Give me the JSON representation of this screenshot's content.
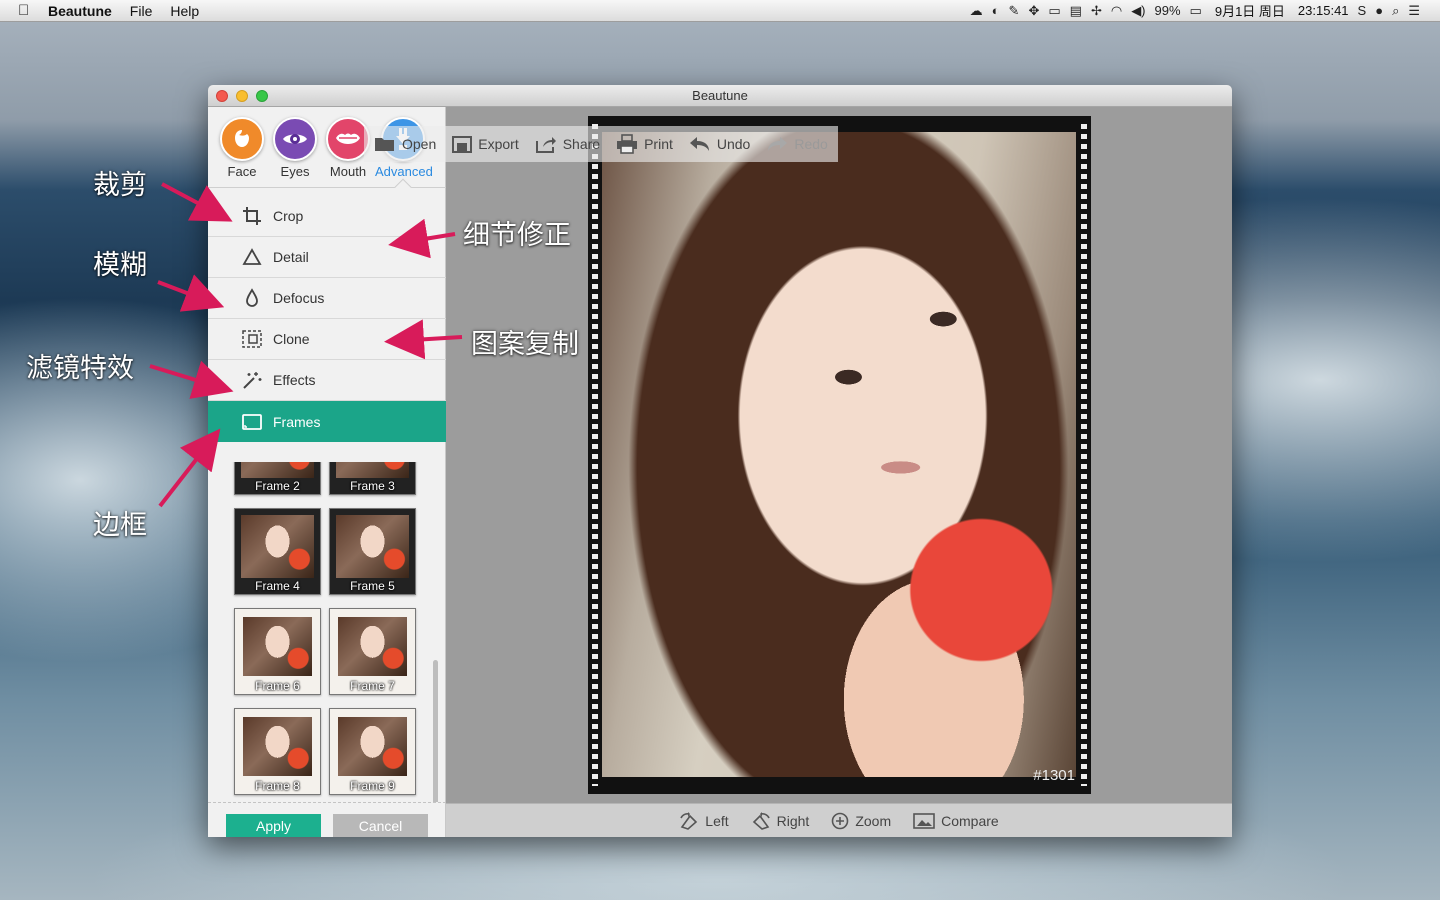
{
  "menubar": {
    "apple": "",
    "app_name": "Beautune",
    "menus": [
      "File",
      "Help"
    ],
    "battery": "99%",
    "date": "9月1日 周日",
    "time": "23:15:41"
  },
  "window": {
    "title": "Beautune"
  },
  "top_tabs": [
    {
      "label": "Face",
      "color": "#f08a2a",
      "icon": "face-icon"
    },
    {
      "label": "Eyes",
      "color": "#7a4bb3",
      "icon": "eye-icon"
    },
    {
      "label": "Mouth",
      "color": "#e2456a",
      "icon": "lips-icon"
    },
    {
      "label": "Advanced",
      "color": "#3d95e6",
      "icon": "advanced-icon"
    }
  ],
  "tools": [
    {
      "label": "Crop",
      "icon": "crop-icon"
    },
    {
      "label": "Detail",
      "icon": "triangle-icon"
    },
    {
      "label": "Defocus",
      "icon": "drop-icon"
    },
    {
      "label": "Clone",
      "icon": "clone-icon"
    },
    {
      "label": "Effects",
      "icon": "magic-wand-icon"
    },
    {
      "label": "Frames",
      "icon": "frame-icon"
    }
  ],
  "frames": [
    "Frame 2",
    "Frame 3",
    "Frame 4",
    "Frame 5",
    "Frame 6",
    "Frame 7",
    "Frame 8",
    "Frame 9"
  ],
  "buttons": {
    "apply": "Apply",
    "cancel": "Cancel"
  },
  "toolbar": {
    "open": "Open",
    "export": "Export",
    "share": "Share",
    "print": "Print",
    "undo": "Undo",
    "redo": "Redo"
  },
  "photo_stamp": "#1301",
  "bottom_bar": {
    "left": "Left",
    "right": "Right",
    "zoom": "Zoom",
    "compare": "Compare"
  },
  "annotations": {
    "crop": "裁剪",
    "defocus": "模糊",
    "effects": "滤镜特效",
    "frames": "边框",
    "detail": "细节修正",
    "clone": "图案复制"
  },
  "colors": {
    "accent": "#1ba589",
    "apply": "#1cb08f",
    "arrow": "#d81b5a",
    "advanced_tab_label": "#2a8ae0"
  }
}
